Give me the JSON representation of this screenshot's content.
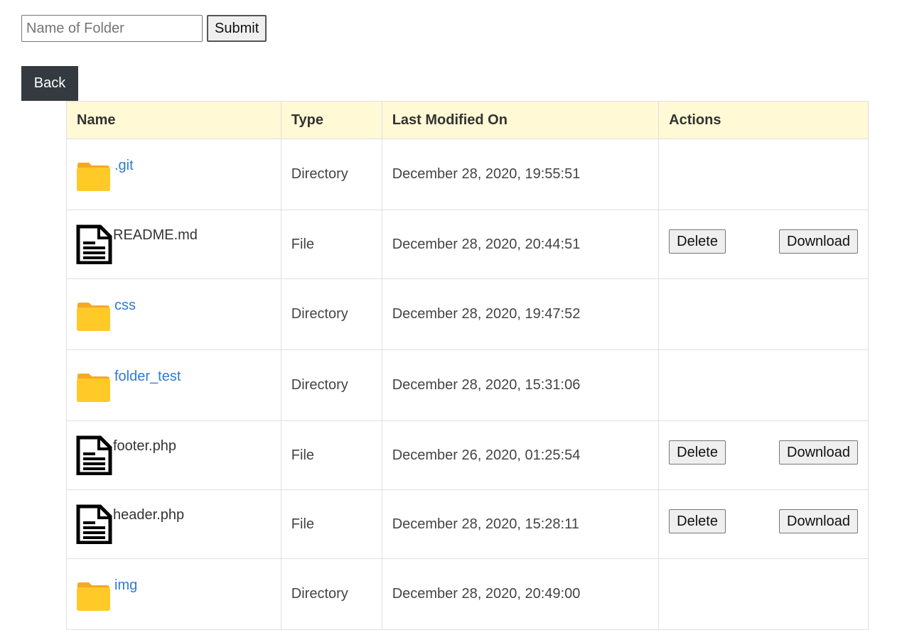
{
  "form": {
    "folder_input_placeholder": "Name of Folder",
    "folder_input_value": "",
    "submit_label": "Submit"
  },
  "nav": {
    "back_label": "Back"
  },
  "table": {
    "headers": {
      "name": "Name",
      "type": "Type",
      "modified": "Last Modified On",
      "actions": "Actions"
    },
    "delete_label": "Delete",
    "download_label": "Download",
    "rows": [
      {
        "name": ".git",
        "type": "Directory",
        "modified": "December 28, 2020, 19:55:51",
        "icon": "folder-icon"
      },
      {
        "name": "README.md",
        "type": "File",
        "modified": "December 28, 2020, 20:44:51",
        "icon": "file-icon"
      },
      {
        "name": "css",
        "type": "Directory",
        "modified": "December 28, 2020, 19:47:52",
        "icon": "folder-icon"
      },
      {
        "name": "folder_test",
        "type": "Directory",
        "modified": "December 28, 2020, 15:31:06",
        "icon": "folder-icon"
      },
      {
        "name": "footer.php",
        "type": "File",
        "modified": "December 26, 2020, 01:25:54",
        "icon": "file-icon"
      },
      {
        "name": "header.php",
        "type": "File",
        "modified": "December 28, 2020, 15:28:11",
        "icon": "file-icon"
      },
      {
        "name": "img",
        "type": "Directory",
        "modified": "December 28, 2020, 20:49:00",
        "icon": "folder-icon"
      }
    ]
  },
  "colors": {
    "header_bg": "#fff9d6",
    "link": "#2f7bd1",
    "back_bg": "#343a40",
    "folder_yellow": "#ffca28"
  }
}
